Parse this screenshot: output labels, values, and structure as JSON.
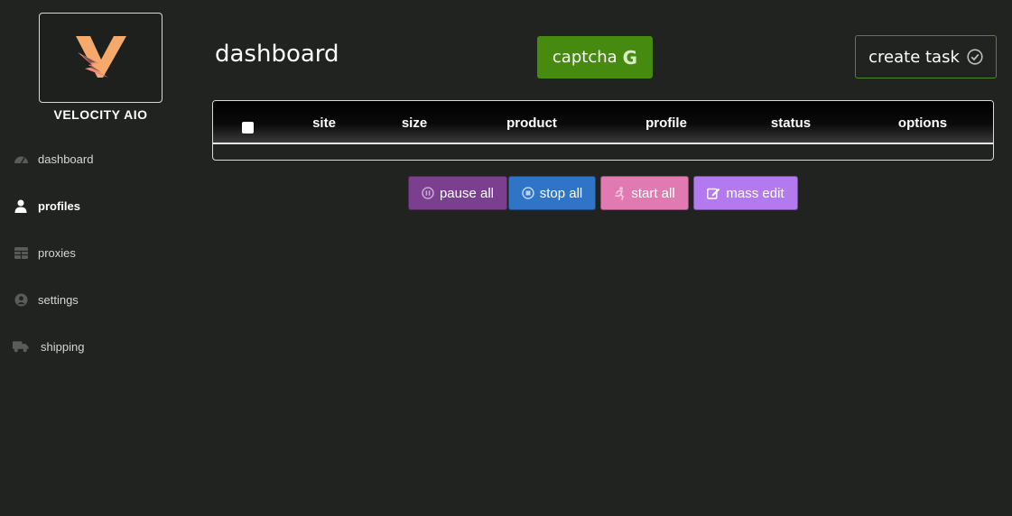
{
  "brand": {
    "name": "VELOCITY AIO"
  },
  "sidebar": {
    "items": [
      {
        "label": "dashboard",
        "icon": "gauge-icon",
        "active": false
      },
      {
        "label": "profiles",
        "icon": "user-icon",
        "active": true
      },
      {
        "label": "proxies",
        "icon": "grid-icon",
        "active": false
      },
      {
        "label": "settings",
        "icon": "user-circle-icon",
        "active": false
      },
      {
        "label": "shipping",
        "icon": "truck-icon",
        "active": false
      }
    ]
  },
  "header": {
    "title": "dashboard",
    "captcha_label": "captcha",
    "captcha_glyph": "G",
    "create_label": "create task"
  },
  "table": {
    "columns": [
      "site",
      "size",
      "product",
      "profile",
      "status",
      "options"
    ],
    "rows": []
  },
  "actions": {
    "pause_label": "pause all",
    "stop_label": "stop all",
    "start_label": "start all",
    "mass_label": "mass edit"
  },
  "colors": {
    "background": "#212321",
    "captcha": "#468a0f",
    "pause": "#7b3f8f",
    "stop": "#2f74c7",
    "start": "#e17ab1",
    "mass_edit": "#b37af0",
    "logo_accent": "#f5a96b"
  }
}
